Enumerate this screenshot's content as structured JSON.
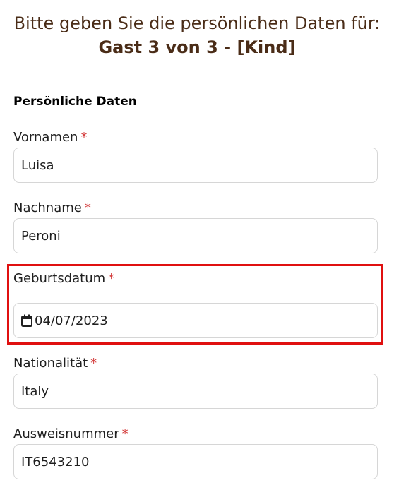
{
  "heading": {
    "line1": "Bitte geben Sie die persönlichen Daten für:",
    "line2": "Gast 3 von 3 - [Kind]"
  },
  "section": {
    "title": "Persönliche Daten"
  },
  "required_marker": "*",
  "fields": {
    "vornamen": {
      "label": "Vornamen",
      "value": "Luisa"
    },
    "nachname": {
      "label": "Nachname",
      "value": "Peroni"
    },
    "geburtsdatum": {
      "label": "Geburtsdatum",
      "value": "04/07/2023",
      "icon": "calendar-icon"
    },
    "nationalitaet": {
      "label": "Nationalität",
      "value": "Italy"
    },
    "ausweisnummer": {
      "label": "Ausweisnummer",
      "value": "IT6543210"
    }
  },
  "colors": {
    "heading": "#4a2c17",
    "required": "#d33a3a",
    "highlight": "#e01010",
    "border": "#d6d6d6"
  }
}
